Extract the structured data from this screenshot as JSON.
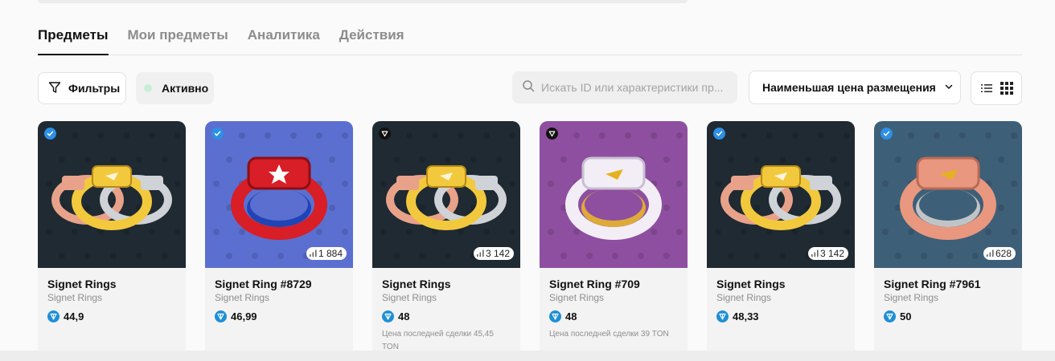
{
  "tabs": [
    {
      "label": "Предметы",
      "active": true
    },
    {
      "label": "Мои предметы",
      "active": false
    },
    {
      "label": "Аналитика",
      "active": false
    },
    {
      "label": "Действия",
      "active": false
    }
  ],
  "toolbar": {
    "filters_label": "Фильтры",
    "status_label": "Активно",
    "search_placeholder": "Искать ID или характеристики пр...",
    "sort_label": "Наименьшая цена размещения"
  },
  "colors": {
    "ton_blue": "#1e8fd6",
    "status_dot": "#c9eed6"
  },
  "items": [
    {
      "name": "Signet Rings",
      "collection": "Signet Rings",
      "price": "44,9",
      "count": "",
      "last_sale": "",
      "badge": "verified-icon",
      "background": "#1f2a33",
      "theme": "trio"
    },
    {
      "name": "Signet Ring #8729",
      "collection": "Signet Rings",
      "price": "46,99",
      "count": "1 884",
      "last_sale": "",
      "badge": "verified-icon",
      "background": "#5b6fd0",
      "theme": "red"
    },
    {
      "name": "Signet Rings",
      "collection": "Signet Rings",
      "price": "48",
      "count": "3 142",
      "last_sale": "Цена последней сделки 45,45 TON",
      "badge": "gift-icon",
      "background": "#1f2a33",
      "theme": "trio"
    },
    {
      "name": "Signet Ring #709",
      "collection": "Signet Rings",
      "price": "48",
      "count": "",
      "last_sale": "Цена последней сделки 39 TON",
      "badge": "gift-icon",
      "background": "#8e4fa0",
      "theme": "pearl"
    },
    {
      "name": "Signet Rings",
      "collection": "Signet Rings",
      "price": "48,33",
      "count": "3 142",
      "last_sale": "",
      "badge": "verified-icon",
      "background": "#1f2a33",
      "theme": "trio"
    },
    {
      "name": "Signet Ring #7961",
      "collection": "Signet Rings",
      "price": "50",
      "count": "628",
      "last_sale": "",
      "badge": "verified-icon",
      "background": "#3e5f78",
      "theme": "rose"
    }
  ]
}
